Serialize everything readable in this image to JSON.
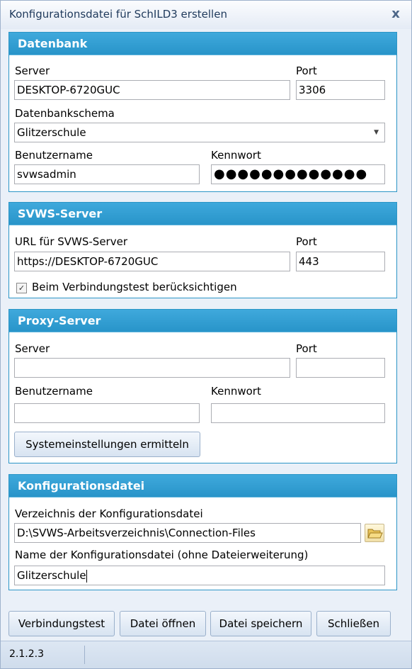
{
  "window": {
    "title": "Konfigurationsdatei für SchILD3 erstellen",
    "close_glyph": "x"
  },
  "datenbank": {
    "header": "Datenbank",
    "server_label": "Server",
    "server_value": "DESKTOP-6720GUC",
    "port_label": "Port",
    "port_value": "3306",
    "schema_label": "Datenbankschema",
    "schema_value": "Glitzerschule",
    "user_label": "Benutzername",
    "user_value": "svwsadmin",
    "password_label": "Kennwort",
    "password_mask": "●●●●●●●●●●●●●"
  },
  "svws": {
    "header": "SVWS-Server",
    "url_label": "URL für SVWS-Server",
    "url_value": "https://DESKTOP-6720GUC",
    "port_label": "Port",
    "port_value": "443",
    "checkbox_label": "Beim Verbindungstest berücksichtigen",
    "checkbox_checked": true
  },
  "proxy": {
    "header": "Proxy-Server",
    "server_label": "Server",
    "server_value": "",
    "port_label": "Port",
    "port_value": "",
    "user_label": "Benutzername",
    "user_value": "",
    "password_label": "Kennwort",
    "password_value": "",
    "detect_button": "Systemeinstellungen ermitteln"
  },
  "konfig": {
    "header": "Konfigurationsdatei",
    "dir_label": "Verzeichnis der Konfigurationsdatei",
    "dir_value": "D:\\SVWS-Arbeitsverzeichnis\\Connection-Files",
    "name_label": "Name der Konfigurationsdatei (ohne Dateierweiterung)",
    "name_value": "Glitzerschule"
  },
  "buttons": {
    "test": "Verbindungstest",
    "open": "Datei öffnen",
    "save": "Datei speichern",
    "close": "Schließen"
  },
  "status": {
    "version": "2.1.2.3"
  },
  "icons": {
    "folder": "folder-open-icon",
    "dropdown": "chevron-down-icon",
    "check": "checkmark-icon"
  }
}
